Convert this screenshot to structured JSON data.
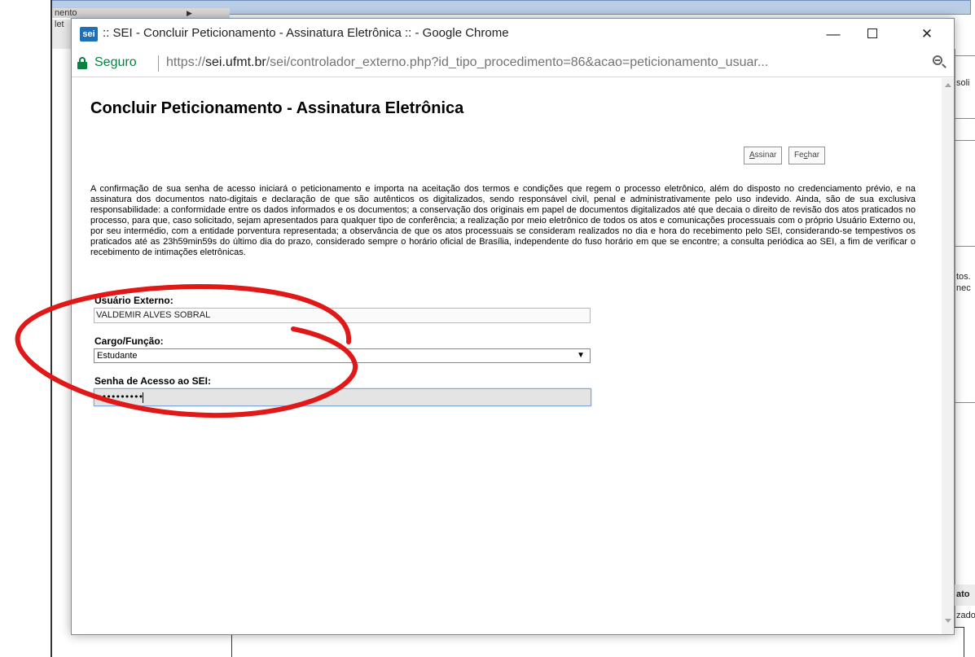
{
  "background": {
    "menu_label": "nento",
    "menu2_label": "let",
    "right_texts": [
      "soli",
      "tos.",
      "nec",
      "ato",
      "zado"
    ]
  },
  "window": {
    "logo_text": "sei",
    "title": ":: SEI - Concluir Peticionamento - Assinatura Eletrônica :: - Google Chrome",
    "minimize_glyph": "—",
    "close_glyph": "✕"
  },
  "addressbar": {
    "secure_label": "Seguro",
    "url_prefix": "https://",
    "url_host": "sei.ufmt.br",
    "url_path": "/sei/controlador_externo.php?id_tipo_procedimento=86&acao=peticionamento_usuar..."
  },
  "page": {
    "title": "Concluir Peticionamento - Assinatura Eletrônica",
    "sign_button": {
      "accesskey": "A",
      "rest": "ssinar"
    },
    "close_button": {
      "prefix": "Fe",
      "accesskey": "c",
      "rest": "har"
    },
    "terms": "A confirmação de sua senha de acesso iniciará o peticionamento e importa na aceitação dos termos e condições que regem o processo eletrônico, além do disposto no credenciamento prévio, e na assinatura dos documentos nato-digitais e declaração de que são autênticos os digitalizados, sendo responsável civil, penal e administrativamente pelo uso indevido. Ainda, são de sua exclusiva responsabilidade: a conformidade entre os dados informados e os documentos; a conservação dos originais em papel de documentos digitalizados até que decaia o direito de revisão dos atos praticados no processo, para que, caso solicitado, sejam apresentados para qualquer tipo de conferência; a realização por meio eletrônico de todos os atos e comunicações processuais com o próprio Usuário Externo ou, por seu intermédio, com a entidade porventura representada; a observância de que os atos processuais se consideram realizados no dia e hora do recebimento pelo SEI, considerando-se tempestivos os praticados até as 23h59min59s do último dia do prazo, considerado sempre o horário oficial de Brasília, independente do fuso horário em que se encontre; a consulta periódica ao SEI, a fim de verificar o recebimento de intimações eletrônicas.",
    "user_label": "Usuário Externo:",
    "user_value": "VALDEMIR ALVES SOBRAL",
    "role_label": "Cargo/Função:",
    "role_value": "Estudante",
    "role_caret": "▼",
    "password_label": "Senha de Acesso ao SEI:",
    "password_mask": "••••••••••"
  },
  "colors": {
    "annotation": "#e01818",
    "secure": "#0b8043",
    "accent": "#1d6fb8"
  }
}
